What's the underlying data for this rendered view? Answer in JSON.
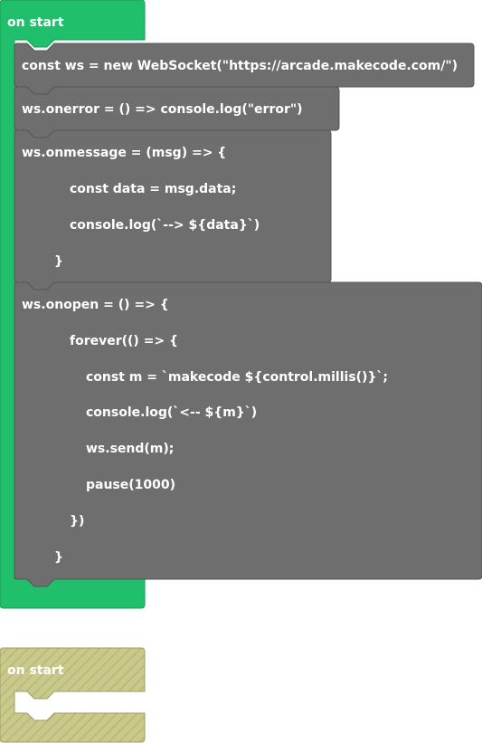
{
  "colors": {
    "event_green": "#1FBF6B",
    "event_green_border": "#199b57",
    "code_gray": "#6E6E6E",
    "code_gray_border": "#555555",
    "disabled_fill": "#C9C98C",
    "disabled_border": "#9e9e62",
    "text": "#ffffff"
  },
  "blocks": {
    "on_start_1": {
      "label": "on start"
    },
    "websocket_stmt": {
      "code": "const ws = new WebSocket(\"https://arcade.makecode.com/\")"
    },
    "onerror_stmt": {
      "code": "ws.onerror = () => console.log(\"error\")"
    },
    "onmessage_stmt": {
      "lines": [
        "ws.onmessage = (msg) => {",
        "const data = msg.data;",
        "console.log(`--> ${data}`)",
        "}"
      ]
    },
    "onopen_stmt": {
      "lines": [
        "ws.onopen = () => {",
        "forever(() => {",
        "const m = `makecode ${control.millis()}`;",
        "console.log(`<-- ${m}`)",
        "ws.send(m);",
        "pause(1000)",
        "})",
        "}"
      ]
    },
    "on_start_2": {
      "label": "on start",
      "state": "disabled"
    }
  }
}
